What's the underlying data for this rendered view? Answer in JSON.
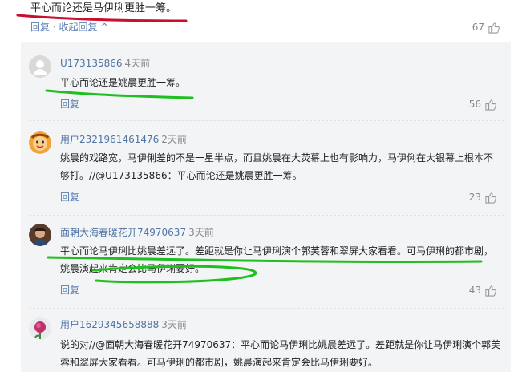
{
  "top": {
    "text": "平心而论还是马伊琍更胜一筹。",
    "reply_label": "回复",
    "separator": "·",
    "collapse_label": "收起回复",
    "collapse_arrow": "^",
    "likes": "67"
  },
  "comments": [
    {
      "username": "U173135866",
      "time": "4天前",
      "text": "平心而论还是姚晨更胜一筹。",
      "reply_label": "回复",
      "likes": "56",
      "avatar_icon": "default-avatar-icon"
    },
    {
      "username": "用户2321961461476",
      "time": "2天前",
      "text": "姚晨的戏路宽，马伊俐差的不是一星半点，而且姚晨在大荧幕上也有影响力，马伊俐在大银幕上根本不够打。//@U173135866：平心而论还是姚晨更胜一筹。",
      "reply_label": "回复",
      "likes": "23",
      "avatar_icon": "cartoon-avatar-icon"
    },
    {
      "username": "面朝大海春暖花开74970637",
      "time": "3天前",
      "text": "平心而论马伊琍比姚晨差远了。差距就是你让马伊琍演个郭芙蓉和翠屏大家看看。可马伊琍的都市剧，姚晨演起来肯定会比马伊琍要好。",
      "reply_label": "回复",
      "likes": "43",
      "avatar_icon": "photo-avatar-icon"
    },
    {
      "username": "用户1629345658888",
      "time": "3天前",
      "text": "说的对//@面朝大海春暖花开74970637：平心而论马伊琍比姚晨差远了。差距就是你让马伊琍演个郭芙蓉和翠屏大家看看。可马伊琍的都市剧，姚晨演起来肯定会比马伊琍要好。",
      "avatar_icon": "flower-avatar-icon"
    }
  ],
  "colors": {
    "link": "#5b7fb0",
    "annotation_red": "#c8102e",
    "annotation_green": "#1fbf1f",
    "thread_bg": "#f3f4f6"
  }
}
